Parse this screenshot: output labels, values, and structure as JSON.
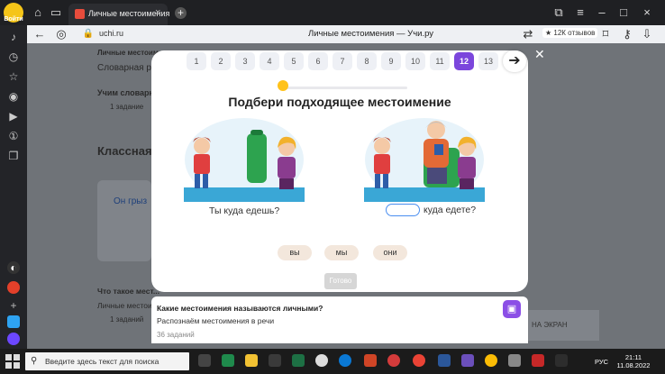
{
  "browser": {
    "login_label": "Войти",
    "tab_title": "Личные местоимения",
    "url": "uchi.ru",
    "page_title": "Личные местоимения — Учи.ру",
    "reviews_badge": "★ 12К отзывов"
  },
  "background": {
    "header_partial": "Личные местоим...",
    "card_title": "Словарная раб...",
    "learn_title": "Учим словарн...",
    "tasks_1": "1 задание",
    "section_title": "Классная р...",
    "word_card": "Он  грыз",
    "what_is": "Что такое мест...",
    "lichnye": "Личные местоим...",
    "tasks_2": "1 заданий",
    "right_btn": "НА ЭКРАН"
  },
  "exercise": {
    "numbers": [
      "1",
      "2",
      "3",
      "4",
      "5",
      "6",
      "7",
      "8",
      "9",
      "10",
      "11",
      "12",
      "13"
    ],
    "active_index": 11,
    "progress": 0.03,
    "heading": "Подбери подходящее местоимение",
    "sentence_left": "Ты куда едешь?",
    "sentence_right": "куда едете?",
    "choices": [
      "вы",
      "мы",
      "они"
    ],
    "check_label": "Готово",
    "next_icon": "arrow-right-icon"
  },
  "info": {
    "title": "Какие местоимения называются личными?",
    "subtitle": "Распознаём местоимения в речи",
    "count": "36 заданий"
  },
  "taskbar": {
    "search_placeholder": "Введите здесь текст для поиска",
    "lang": "РУС",
    "time": "21:11",
    "date": "11.08.2022"
  },
  "colors": {
    "accent": "#7b46dc",
    "progress": "#ffc21a",
    "choice_bg": "#f3e7dc",
    "blank_border": "#4a8ef0"
  }
}
